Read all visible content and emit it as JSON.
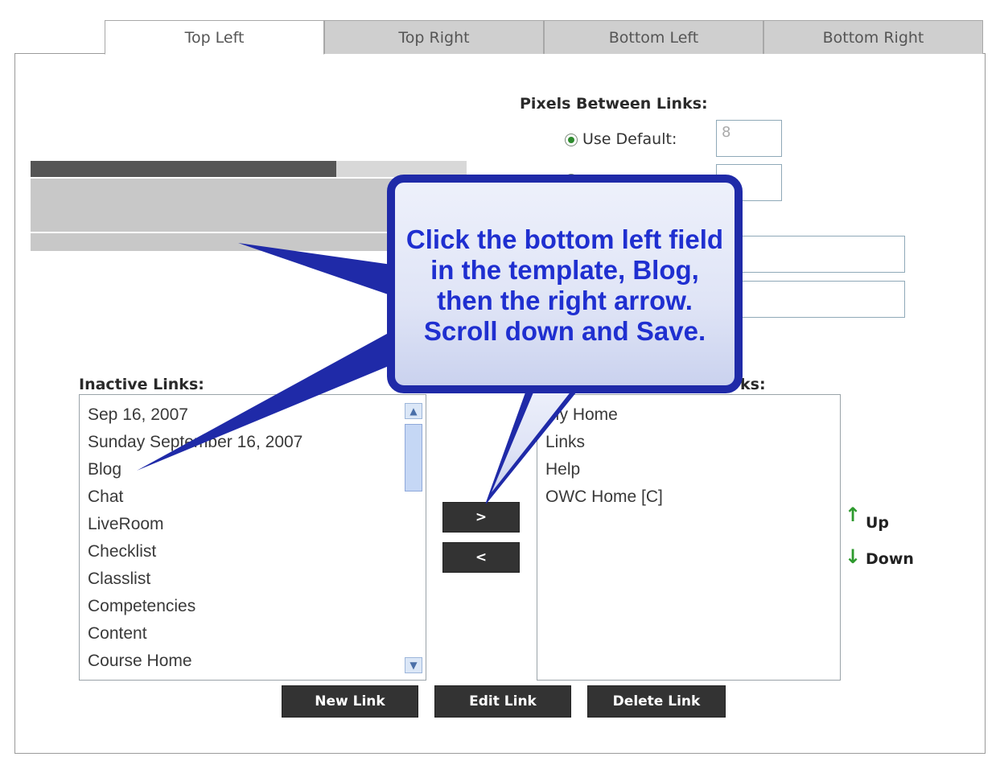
{
  "tabs": [
    {
      "label": "Top Left",
      "active": true
    },
    {
      "label": "Top Right",
      "active": false
    },
    {
      "label": "Bottom Left",
      "active": false
    },
    {
      "label": "Bottom Right",
      "active": false
    }
  ],
  "pixels": {
    "heading": "Pixels Between Links:",
    "use_default_label": "Use Default:",
    "default_value": "8",
    "custom_value": ""
  },
  "inactive": {
    "heading": "Inactive Links:",
    "items": [
      "Sep 16, 2007",
      "Sunday September 16, 2007",
      "Blog",
      "Chat",
      "LiveRoom",
      "Checklist",
      "Classlist",
      "Competencies",
      "Content",
      "Course Home"
    ]
  },
  "active": {
    "heading_suffix": "ks:",
    "items": [
      "My Home",
      "Links",
      "Help",
      "OWC Home [C]"
    ]
  },
  "move_buttons": {
    "right": ">",
    "left": "<"
  },
  "order": {
    "up": "Up",
    "down": "Down"
  },
  "footer_buttons": {
    "new": "New Link",
    "edit": "Edit Link",
    "delete": "Delete Link"
  },
  "callout": {
    "text": "Click the bottom left field in the template, Blog, then the right arrow.  Scroll down and Save."
  },
  "colors": {
    "accent_green": "#2e9a2e",
    "callout_text": "#1f2fd0",
    "button_dark": "#333333"
  }
}
